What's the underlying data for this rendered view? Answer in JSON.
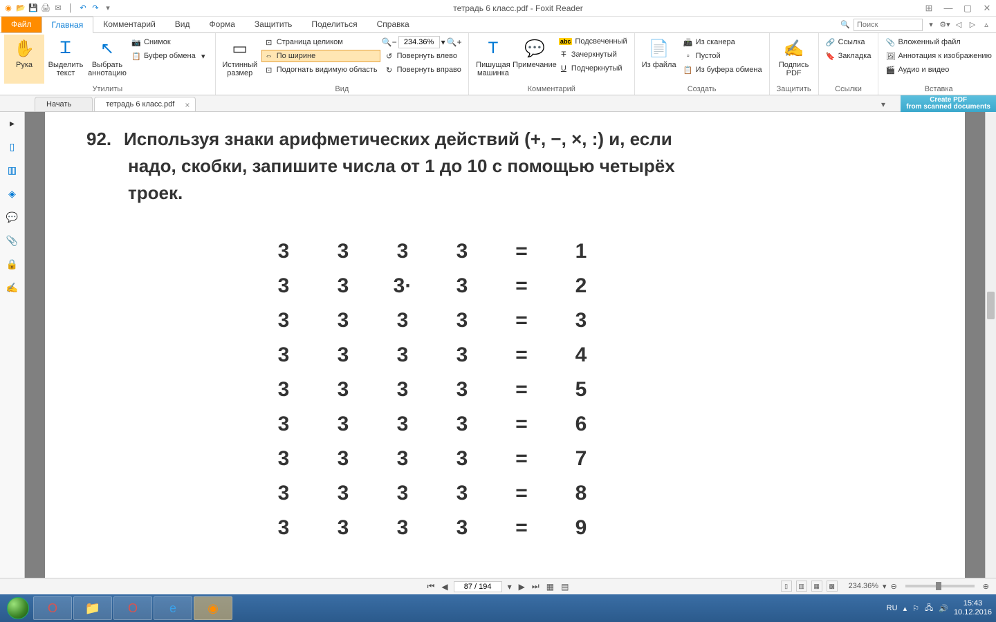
{
  "titlebar": {
    "title": "тетрадь 6 класс.pdf - Foxit Reader"
  },
  "tabs": {
    "file": "Файл",
    "home": "Главная",
    "comments": "Комментарий",
    "view": "Вид",
    "form": "Форма",
    "protect": "Защитить",
    "share": "Поделиться",
    "help": "Справка"
  },
  "search": {
    "placeholder": "Поиск"
  },
  "ribbon": {
    "hand": "Рука",
    "select_text": "Выделить текст",
    "select_annotation": "Выбрать аннотацию",
    "snapshot": "Снимок",
    "clipboard": "Буфер обмена",
    "utilities_group": "Утилиты",
    "actual_size": "Истинный размер",
    "whole_page": "Страница целиком",
    "fit_width": "По ширине",
    "fit_visible": "Подогнать видимую область",
    "zoom_value": "234.36%",
    "rotate_left": "Повернуть влево",
    "rotate_right": "Повернуть вправо",
    "view_group": "Вид",
    "typewriter": "Пишущая машинка",
    "note": "Примечание",
    "highlight": "Подсвеченный",
    "strikeout": "Зачеркнутый",
    "underline": "Подчеркнутый",
    "comment_group": "Комментарий",
    "from_file": "Из файла",
    "from_scanner": "Из сканера",
    "blank": "Пустой",
    "from_clipboard": "Из буфера обмена",
    "create_group": "Создать",
    "pdf_sign": "Подпись PDF",
    "protect_group": "Защитить",
    "link": "Ссылка",
    "bookmark": "Закладка",
    "links_group": "Ссылки",
    "file_attach": "Вложенный файл",
    "image_annot": "Аннотация к изображению",
    "audio_video": "Аудио и видео",
    "insert_group": "Вставка"
  },
  "doctabs": {
    "start": "Начать",
    "doc": "тетрадь 6 класс.pdf",
    "promo_line1": "Create PDF",
    "promo_line2": "from scanned documents"
  },
  "document": {
    "task_number": "92.",
    "task_line1": "Используя знаки арифметических действий (+, −, ×, :) и, если",
    "task_line2": "надо, скобки, запишите числа от 1 до 10 с помощью четырёх",
    "task_line3": "троек.",
    "rows": [
      [
        "3",
        "3",
        "3",
        "3",
        "=",
        "1"
      ],
      [
        "3",
        "3",
        "3·",
        "3",
        "=",
        "2"
      ],
      [
        "3",
        "3",
        "3",
        "3",
        "=",
        "3"
      ],
      [
        "3",
        "3",
        "3",
        "3",
        "=",
        "4"
      ],
      [
        "3",
        "3",
        "3",
        "3",
        "=",
        "5"
      ],
      [
        "3",
        "3",
        "3",
        "3",
        "=",
        "6"
      ],
      [
        "3",
        "3",
        "3",
        "3",
        "=",
        "7"
      ],
      [
        "3",
        "3",
        "3",
        "3",
        "=",
        "8"
      ],
      [
        "3",
        "3",
        "3",
        "3",
        "=",
        "9"
      ]
    ]
  },
  "pagenav": {
    "page_field": "87 / 194"
  },
  "statusbar": {
    "zoom": "234.36%"
  },
  "taskbar": {
    "lang": "RU",
    "time": "15:43",
    "date": "10.12.2016"
  }
}
